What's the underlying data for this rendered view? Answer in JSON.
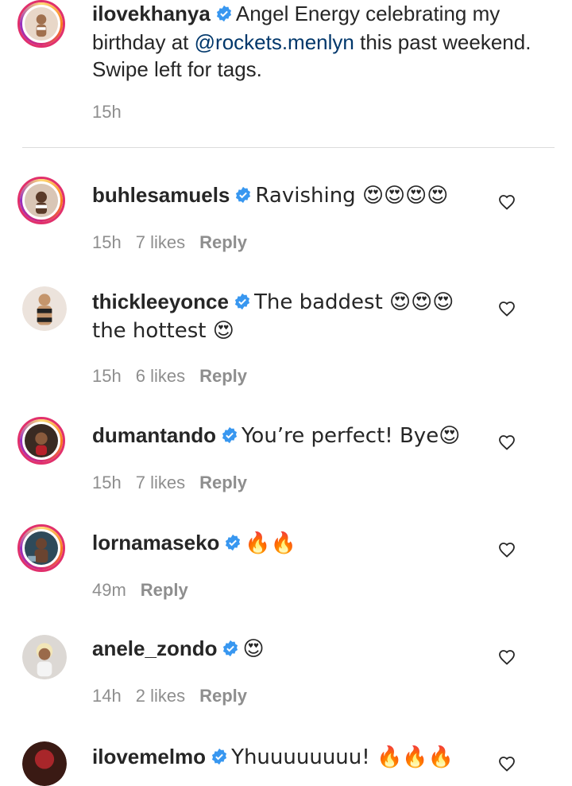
{
  "caption": {
    "username": "ilovekhanya",
    "text_before": "Angel Energy celebrating my birthday at ",
    "mention": "@rockets.menlyn",
    "text_after": " this past weekend. Swipe left for tags.",
    "time": "15h"
  },
  "comments": [
    {
      "username": "buhlesamuels",
      "text": "Ravishing 😍😍😍😍",
      "time": "15h",
      "likes": "7 likes",
      "reply": "Reply"
    },
    {
      "username": "thickleeyonce",
      "text": "The baddest 😍😍😍 the hottest 😍",
      "time": "15h",
      "likes": "6 likes",
      "reply": "Reply"
    },
    {
      "username": "dumantando",
      "text": "You’re perfect! Bye😍",
      "time": "15h",
      "likes": "7 likes",
      "reply": "Reply"
    },
    {
      "username": "lornamaseko",
      "text": "🔥🔥",
      "time": "49m",
      "likes": "",
      "reply": "Reply"
    },
    {
      "username": "anele_zondo",
      "text": "😍",
      "time": "14h",
      "likes": "2 likes",
      "reply": "Reply"
    },
    {
      "username": "ilovemelmo",
      "text": "Yhuuuuuuuu! 🔥🔥🔥",
      "time": "",
      "likes": "",
      "reply": ""
    }
  ],
  "colors": {
    "verified": "#3897f0",
    "mention": "#00376b",
    "meta": "#8e8e8e"
  },
  "icons": [
    "verified-badge-icon",
    "heart-icon"
  ]
}
